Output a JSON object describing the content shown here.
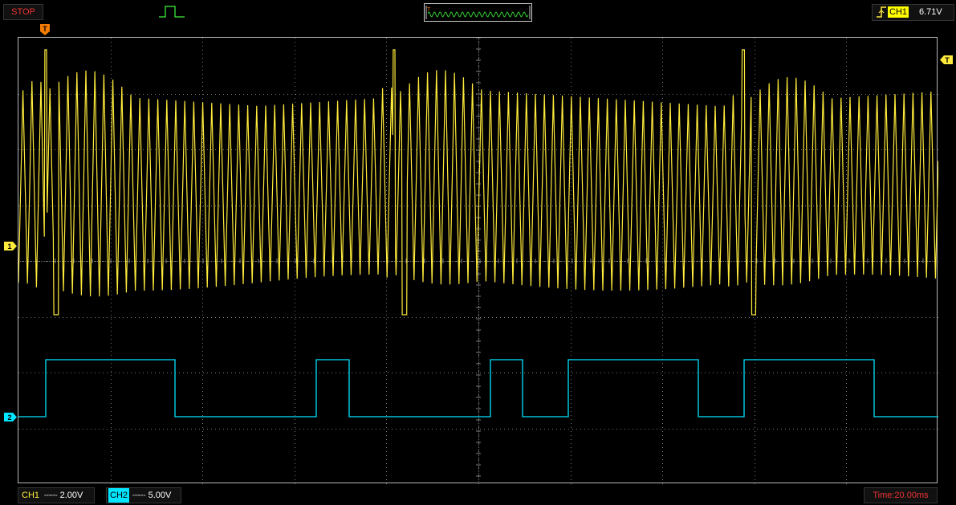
{
  "run_state": {
    "label": "STOP",
    "color": "#e53935"
  },
  "trigger_mode_icon": "pulse-icon",
  "trigger": {
    "channel": "CH1",
    "level": "6.71V",
    "edge_icon": "rising-edge-icon",
    "marker": "T"
  },
  "channels": [
    {
      "id": "ch1",
      "label": "CH1",
      "coupling": "DC",
      "scale": "2.00V",
      "marker": "1",
      "color": "#ffeb3b"
    },
    {
      "id": "ch2",
      "label": "CH2",
      "coupling": "DC",
      "scale": "5.00V",
      "marker": "2",
      "color": "#00e5ff"
    }
  ],
  "timebase": {
    "label": "Time:20.00ms"
  },
  "colors": {
    "ch1": "#ffeb3b",
    "ch2": "#00e5ff",
    "grid": "#7a7a7a",
    "trigger_marker": "#f57c00",
    "stop": "#e53935"
  }
}
